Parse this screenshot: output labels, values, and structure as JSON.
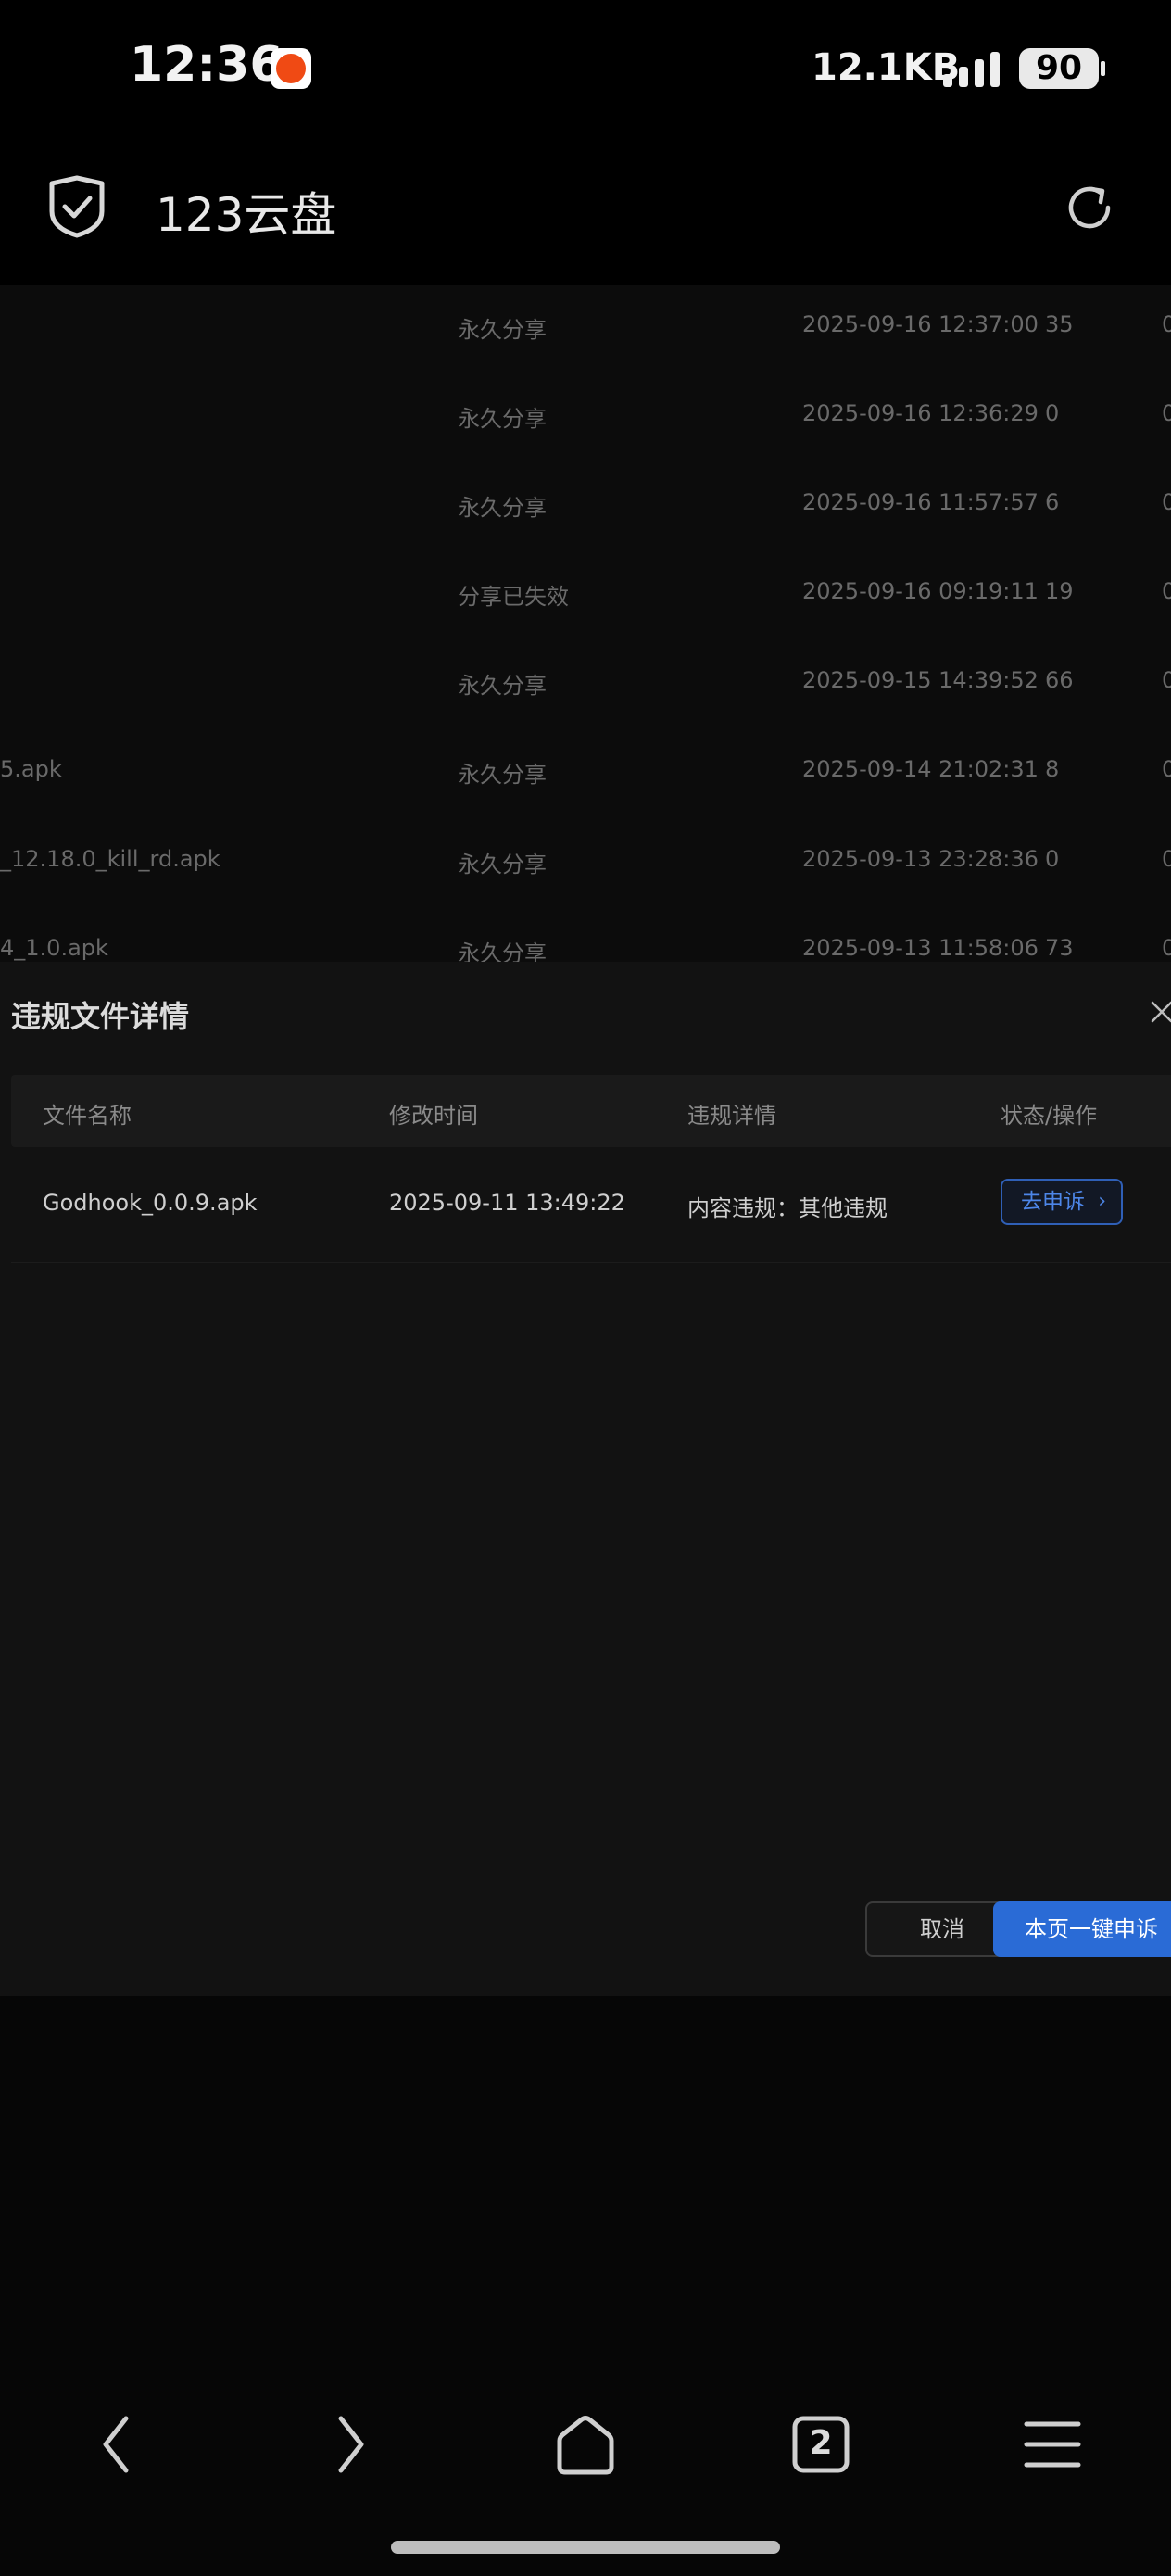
{
  "status_bar": {
    "time": "12:36",
    "network_speed": "12.1KB",
    "battery": "90",
    "app_icon": "notification-app-icon"
  },
  "app_bar": {
    "title": "123云盘",
    "left_icon": "shield-check-icon",
    "right_icon": "refresh-icon"
  },
  "share_list": {
    "rows": [
      {
        "name": "",
        "status": "永久分享",
        "time": "2025-09-16 12:37:00",
        "count": "35",
        "tail": "0"
      },
      {
        "name": "",
        "status": "永久分享",
        "time": "2025-09-16 12:36:29",
        "count": "0",
        "tail": "0"
      },
      {
        "name": "",
        "status": "永久分享",
        "time": "2025-09-16 11:57:57",
        "count": "6",
        "tail": "0"
      },
      {
        "name": "",
        "status": "分享已失效",
        "time": "2025-09-16 09:19:11",
        "count": "19",
        "tail": "0"
      },
      {
        "name": "",
        "status": "永久分享",
        "time": "2025-09-15 14:39:52",
        "count": "66",
        "tail": "0"
      },
      {
        "name": "5.apk",
        "status": "永久分享",
        "time": "2025-09-14 21:02:31",
        "count": "8",
        "tail": "0"
      },
      {
        "name": "_12.18.0_kill_rd.apk",
        "status": "永久分享",
        "time": "2025-09-13 23:28:36",
        "count": "0",
        "tail": "0"
      },
      {
        "name": "4_1.0.apk",
        "status": "永久分享",
        "time": "2025-09-13 11:58:06",
        "count": "73",
        "tail": "0"
      }
    ]
  },
  "modal": {
    "title": "违规文件详情",
    "columns": [
      "文件名称",
      "修改时间",
      "违规详情",
      "状态/操作"
    ],
    "rows": [
      {
        "file_name": "Godhook_0.0.9.apk",
        "modified": "2025-09-11 13:49:22",
        "violation": "内容违规：其他违规",
        "action_label": "去申诉"
      }
    ],
    "cancel_label": "取消",
    "appeal_all_label": "本页一键申诉"
  },
  "bottom_nav": {
    "tab_count": "2"
  },
  "colors": {
    "accent": "#2a6bd6",
    "background": "#060606",
    "modal_background": "#121212"
  }
}
